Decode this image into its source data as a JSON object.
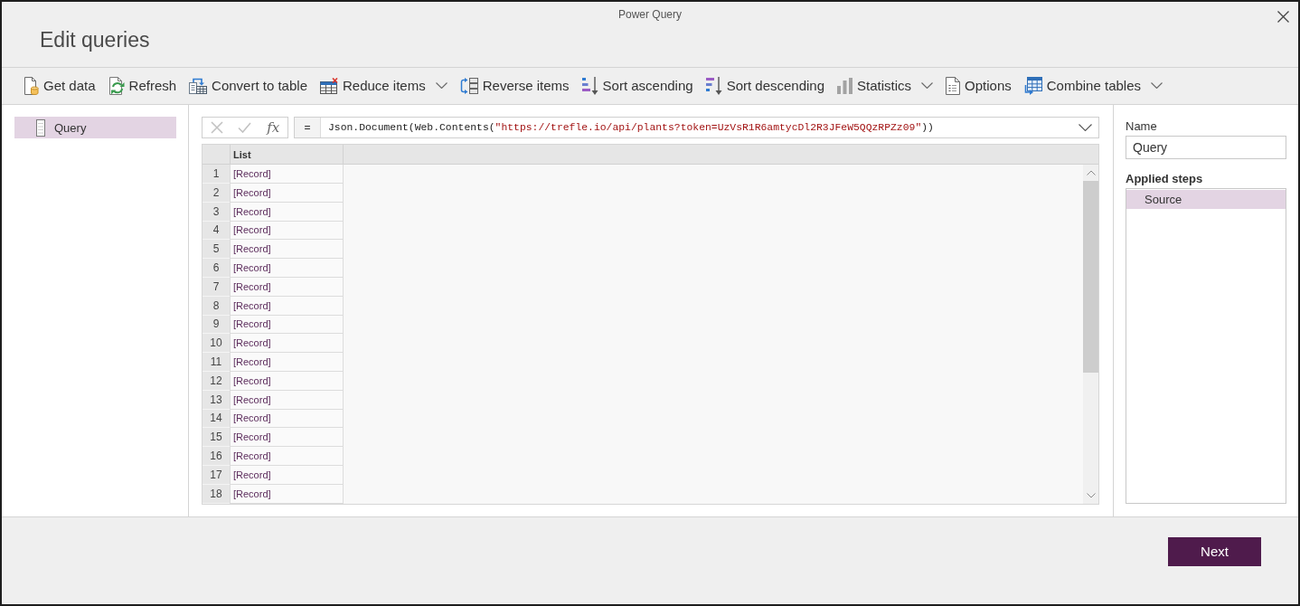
{
  "dialog": {
    "title": "Power Query",
    "heading": "Edit queries"
  },
  "toolbar": [
    {
      "label": "Get data",
      "dropdown": false
    },
    {
      "label": "Refresh",
      "dropdown": false
    },
    {
      "label": "Convert to table",
      "dropdown": false
    },
    {
      "label": "Reduce items",
      "dropdown": true
    },
    {
      "label": "Reverse items",
      "dropdown": false
    },
    {
      "label": "Sort ascending",
      "dropdown": false
    },
    {
      "label": "Sort descending",
      "dropdown": false
    },
    {
      "label": "Statistics",
      "dropdown": true
    },
    {
      "label": "Options",
      "dropdown": false
    },
    {
      "label": "Combine tables",
      "dropdown": true
    }
  ],
  "queries": [
    {
      "label": "Query",
      "selected": true
    }
  ],
  "formula_bar": {
    "buttons": [
      {
        "kind": "cancel",
        "disabled": true
      },
      {
        "kind": "commit",
        "disabled": true
      },
      {
        "kind": "function",
        "label": "fx",
        "disabled": false
      }
    ],
    "equals": "=",
    "formula": [
      {
        "kind": "code",
        "text": "Json.Document(Web.Contents("
      },
      {
        "kind": "string",
        "text": "\"https://trefle.io/api/plants?token=UzVsR1R6amtycDl2R3JFeW5QQzRPZz09\""
      },
      {
        "kind": "code",
        "text": "))"
      }
    ]
  },
  "table": {
    "columns": [
      "List"
    ],
    "rows": [
      {
        "number": "1",
        "cells": [
          "[Record]"
        ]
      },
      {
        "number": "2",
        "cells": [
          "[Record]"
        ]
      },
      {
        "number": "3",
        "cells": [
          "[Record]"
        ]
      },
      {
        "number": "4",
        "cells": [
          "[Record]"
        ]
      },
      {
        "number": "5",
        "cells": [
          "[Record]"
        ]
      },
      {
        "number": "6",
        "cells": [
          "[Record]"
        ]
      },
      {
        "number": "7",
        "cells": [
          "[Record]"
        ]
      },
      {
        "number": "8",
        "cells": [
          "[Record]"
        ]
      },
      {
        "number": "9",
        "cells": [
          "[Record]"
        ]
      },
      {
        "number": "10",
        "cells": [
          "[Record]"
        ]
      },
      {
        "number": "11",
        "cells": [
          "[Record]"
        ]
      },
      {
        "number": "12",
        "cells": [
          "[Record]"
        ]
      },
      {
        "number": "13",
        "cells": [
          "[Record]"
        ]
      },
      {
        "number": "14",
        "cells": [
          "[Record]"
        ]
      },
      {
        "number": "15",
        "cells": [
          "[Record]"
        ]
      },
      {
        "number": "16",
        "cells": [
          "[Record]"
        ]
      },
      {
        "number": "17",
        "cells": [
          "[Record]"
        ]
      },
      {
        "number": "18",
        "cells": [
          "[Record]"
        ]
      }
    ]
  },
  "query_settings": {
    "name_label": "Name",
    "name_value": "Query",
    "steps_label": "Applied steps",
    "steps": [
      {
        "label": "Source",
        "selected": true
      }
    ]
  },
  "footer": {
    "buttons": [
      {
        "label": "Next",
        "kind": "primary"
      }
    ]
  }
}
